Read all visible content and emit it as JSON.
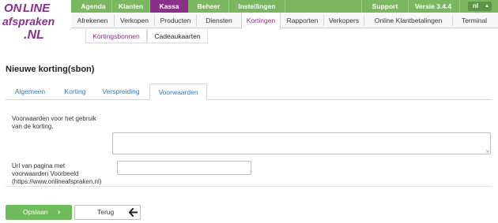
{
  "logo": {
    "text": "ONLINE afspraken.NL",
    "line1": "ON",
    "line2": "LINE",
    "line3": "afspraken",
    "line4": ".NL"
  },
  "topnav": {
    "items": [
      "Agenda",
      "Klanten",
      "Kassa",
      "Beheer",
      "Instellingen"
    ],
    "active": "Kassa",
    "support": "Support",
    "version": "Versie 3.4.4",
    "language": "nl"
  },
  "subnav": {
    "items": [
      "Afrekenen",
      "Verkopen",
      "Producten",
      "Diensten",
      "Kortingen",
      "Rapporten",
      "Verkopers",
      "Online Klantbetalingen",
      "Terminal"
    ],
    "active": "Kortingen"
  },
  "subsubnav": {
    "items": [
      "Kortingsbonnen",
      "Cadeaukaarten"
    ],
    "active": "Kortingsbonnen"
  },
  "page": {
    "title": "Nieuwe korting(sbon)"
  },
  "tabs": {
    "items": [
      "Algemeen",
      "Korting",
      "Verspreiding",
      "Voorwaarden"
    ],
    "active": "Voorwaarden"
  },
  "form": {
    "terms_label": "Voorwaarden voor het gebruik van de korting.",
    "terms_label_line1": "Voorwaarden voor het gebruik",
    "terms_label_line2": "van de korting.",
    "terms_value": "",
    "url_label_line1": "Url van pagina met",
    "url_label_line2": "voorwaarden Voorbeeld",
    "url_label_line3": "(https://www.onlineafspraken.nl)",
    "url_value": ""
  },
  "buttons": {
    "save": "Opslaan",
    "back": "Terug"
  },
  "colors": {
    "brand_purple": "#8c2f8a",
    "nav_green": "#7bb661",
    "save_green": "#6dbb5a",
    "tab_blue": "#3277b5"
  }
}
